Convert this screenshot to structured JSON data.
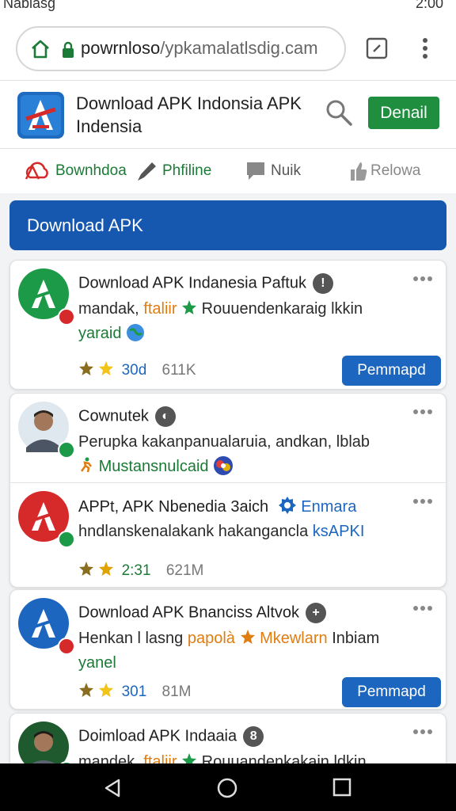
{
  "status_bar": {
    "left_text": "Nablasg",
    "time": "2:00"
  },
  "browser": {
    "url_prefix": "powrnloso",
    "url_rest": "/ypkamalatlsdig.cam",
    "icons": [
      "home-icon",
      "lock-icon",
      "tabs-icon",
      "overflow-menu-icon"
    ]
  },
  "app_header": {
    "title": "Download APK Indonsia APK Indensia",
    "action_label": "Denail",
    "colors": {
      "brand_blue": "#1e6bc0",
      "action_green": "#1f8e3f"
    }
  },
  "nav_tabs": [
    {
      "label": "Bownhdoa",
      "icon": "download-cloud-icon"
    },
    {
      "label": "Phfiline",
      "icon": "pen-icon"
    },
    {
      "label": "Nuik",
      "icon": "chat-bubble-icon"
    },
    {
      "label": "Relowa",
      "icon": "thumbs-up-icon"
    }
  ],
  "banner": {
    "label": "Download APK",
    "color": "#1658b0"
  },
  "cards": [
    {
      "title": "Download APK Indanesia Paftuk",
      "title_icon": "!",
      "desc_prefix": "mandak,",
      "desc_highlight_orange": "ftaliir",
      "desc_rest": "Rouuendenkaraig lkkin",
      "desc_line2": "yaraid",
      "rating": "30d",
      "downloads": "611K",
      "button_label": "Pemmapd"
    },
    {
      "title": "Cownutek",
      "title_icon": "◐",
      "desc_prefix": "Perupka kakanpanualaruia, andkan, lblab",
      "desc_highlight_green": "Mustansnulcaid"
    },
    {
      "title": "APPt, APK Nbenedia 3aich",
      "title_link": "Enmara",
      "desc_prefix": "hndlanskenalakank hakangancla",
      "desc_highlight_blue": "ksAPKI",
      "rating": "2:31",
      "downloads": "621M"
    },
    {
      "title": "Download APK Bnanciss Altvok",
      "title_icon": "+",
      "desc_prefix": "Henkan l lasng",
      "desc_highlight_orange": "papolà",
      "desc_highlight_orange2": "Mkewlarn",
      "desc_rest": "Inbiam",
      "desc_line2": "yanel",
      "rating": "301",
      "downloads": "81M",
      "button_label": "Pemmapd"
    },
    {
      "title": "Doimload APK Indaaia",
      "title_icon": "8",
      "desc_prefix": "mandek,",
      "desc_highlight_orange": "ftaliir",
      "desc_rest": "Rouuandenkakain ldkin"
    }
  ]
}
